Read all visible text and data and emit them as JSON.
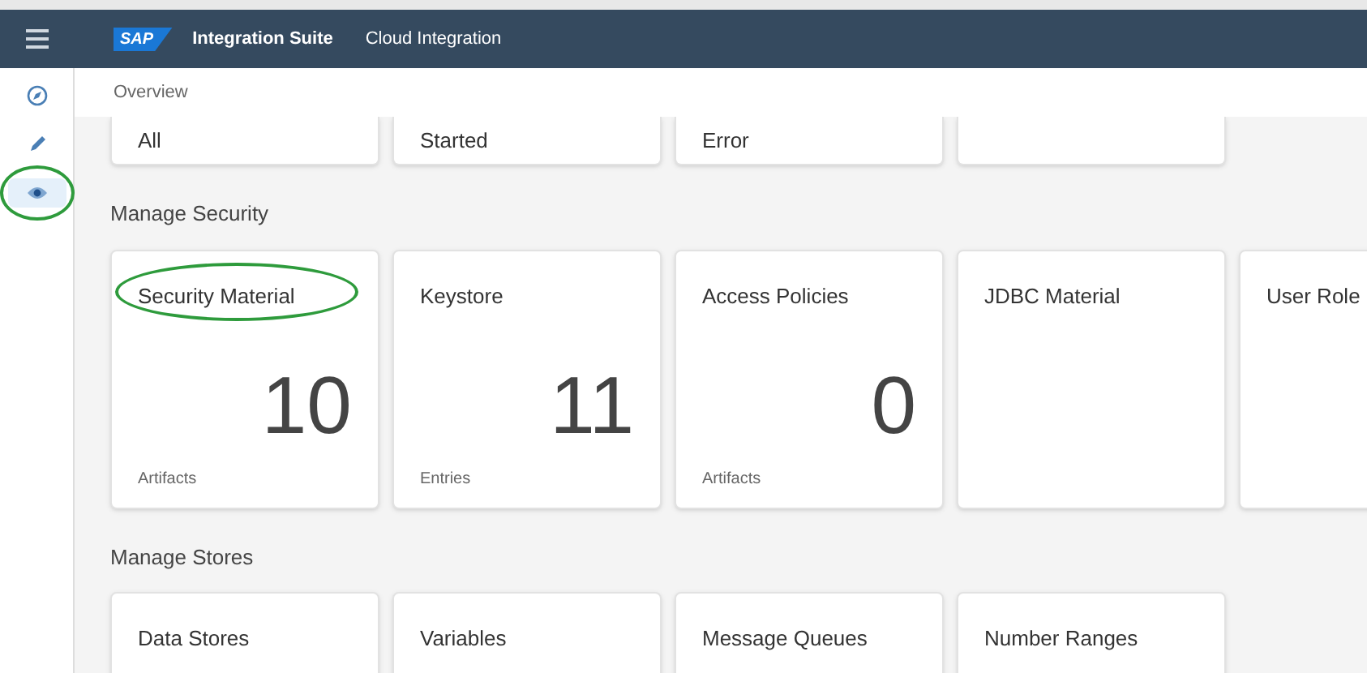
{
  "header": {
    "logo": "SAP",
    "product": "Integration Suite",
    "app": "Cloud Integration"
  },
  "nav": [
    {
      "selected": false,
      "annotated": false
    },
    {
      "selected": false,
      "annotated": false
    },
    {
      "selected": true,
      "annotated": true
    }
  ],
  "breadcrumb": "Overview",
  "top_tiles": [
    {
      "kind": "status",
      "title": "All"
    },
    {
      "kind": "status",
      "title": "Started"
    },
    {
      "kind": "status",
      "title": "Error"
    },
    {
      "kind": "blank"
    }
  ],
  "sections": [
    {
      "title": "Manage Security",
      "tiles": [
        {
          "title": "Security Material",
          "count": "10",
          "unit": "Artifacts",
          "annotated": true
        },
        {
          "title": "Keystore",
          "count": "11",
          "unit": "Entries",
          "annotated": false
        },
        {
          "title": "Access Policies",
          "count": "0",
          "unit": "Artifacts",
          "annotated": false
        },
        {
          "title": "JDBC Material",
          "annotated": false
        },
        {
          "title": "User Role",
          "annotated": false
        }
      ]
    },
    {
      "title": "Manage Stores",
      "tiles": [
        {
          "title": "Data Stores",
          "annotated": false
        },
        {
          "title": "Variables",
          "annotated": false
        },
        {
          "title": "Message Queues",
          "annotated": false
        },
        {
          "title": "Number Ranges",
          "annotated": false
        }
      ]
    }
  ]
}
